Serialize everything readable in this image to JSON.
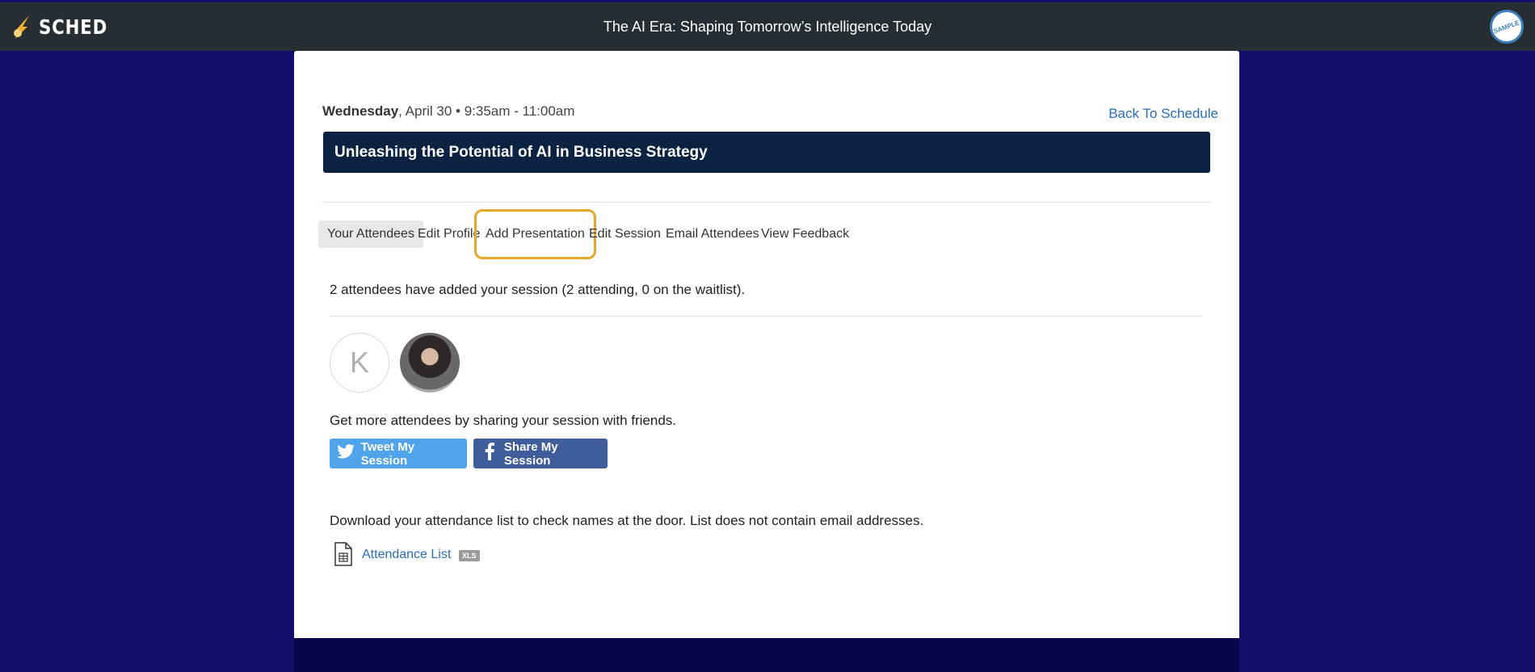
{
  "header": {
    "brand": "SCHED",
    "event_title": "The AI Era: Shaping Tomorrow’s Intelligence Today",
    "badge_text": "SAMPLE"
  },
  "session": {
    "day": "Wednesday",
    "date_time": ", April 30 • 9:35am - 11:00am",
    "back_label": "Back To Schedule",
    "title": "Unleashing the Potential of AI in Business Strategy"
  },
  "tabs": [
    {
      "label": "Your Attendees",
      "active": true
    },
    {
      "label": "Edit Profile"
    },
    {
      "label": "Add Presentation",
      "highlighted": true
    },
    {
      "label": "Edit Session"
    },
    {
      "label": "Email Attendees"
    },
    {
      "label": "View Feedback"
    }
  ],
  "attendees": {
    "summary": "2 attendees have added your session (2 attending, 0 on the waitlist).",
    "avatar_initial": "K"
  },
  "share": {
    "prompt": "Get more attendees by sharing your session with friends.",
    "tweet_label": "Tweet My Session",
    "facebook_label": "Share My Session"
  },
  "download": {
    "prompt": "Download your attendance list to check names at the door. List does not contain email addresses.",
    "link_label": "Attendance List",
    "file_type": "XLS"
  },
  "colors": {
    "page_bg": "#130e6b",
    "topbar": "#262e34",
    "banner": "#0b2242",
    "link": "#2a6db4",
    "twitter": "#4fa4eb",
    "facebook": "#3f5c9b",
    "highlight": "#e5a82b"
  },
  "icons": [
    "sched-logo-icon",
    "twitter-icon",
    "facebook-icon",
    "spreadsheet-file-icon"
  ]
}
